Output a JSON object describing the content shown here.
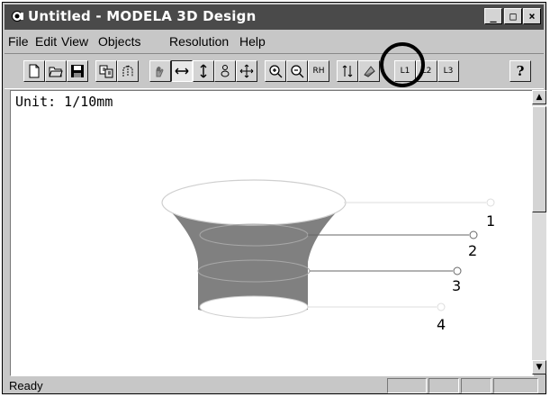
{
  "window": {
    "title": "Untitled - MODELA 3D Design"
  },
  "title_buttons": {
    "minimize": "_",
    "maximize": "□",
    "close": "×"
  },
  "menu": [
    {
      "label": "File"
    },
    {
      "label": "Edit"
    },
    {
      "label": "View"
    },
    {
      "label": "Objects"
    },
    {
      "label": "Resolution"
    },
    {
      "label": "Help"
    }
  ],
  "toolbar": {
    "layers": [
      "L1",
      "L2",
      "L3"
    ],
    "help": "?",
    "rh_label": "RH"
  },
  "canvas": {
    "unit_label": "Unit: 1/10mm",
    "markers": [
      "1",
      "2",
      "3",
      "4"
    ]
  },
  "status": {
    "text": "Ready"
  }
}
